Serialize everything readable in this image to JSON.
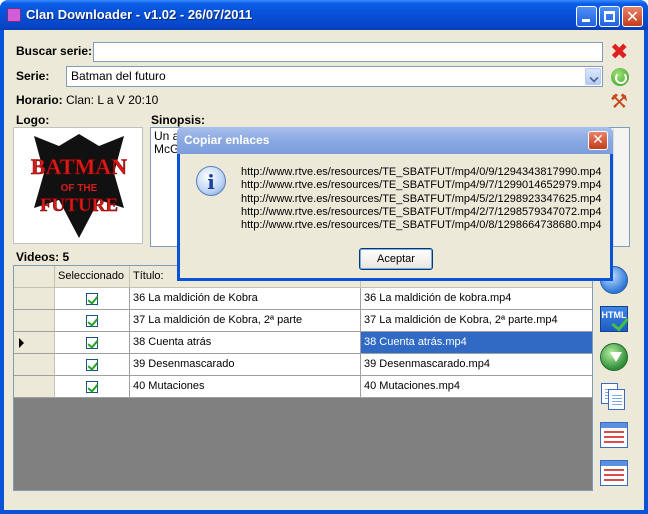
{
  "window": {
    "title": "Clan Downloader - v1.02 - 26/07/2011"
  },
  "form": {
    "search_label": "Buscar serie:",
    "search_value": "",
    "series_label": "Serie:",
    "series_value": "Batman del futuro",
    "schedule_label": "Horario:",
    "schedule_value": "Clan: L a V 20:10",
    "logo_label": "Logo:",
    "synopsis_label": "Sinopsis:",
    "synopsis_text": "Un a\nMcG",
    "videos_label": "Videos: 5"
  },
  "logo": {
    "line1": "BATMAN",
    "line2": "OF THE",
    "line3": "FUTURE"
  },
  "grid": {
    "headers": [
      "",
      "Seleccionado",
      "Título:",
      ""
    ],
    "rows": [
      {
        "selected": true,
        "title": "36 La maldición de Kobra",
        "file": "36 La maldición de kobra.mp4",
        "current": false
      },
      {
        "selected": true,
        "title": "37 La maldición de Kobra, 2ª parte",
        "file": "37 La maldición de Kobra, 2ª parte.mp4",
        "current": false
      },
      {
        "selected": true,
        "title": "38 Cuenta atrás",
        "file": "38 Cuenta atrás.mp4",
        "current": true
      },
      {
        "selected": true,
        "title": "39 Desenmascarado",
        "file": "39 Desenmascarado.mp4",
        "current": false
      },
      {
        "selected": true,
        "title": "40 Mutaciones",
        "file": "40 Mutaciones.mp4",
        "current": false
      }
    ]
  },
  "dialog": {
    "title": "Copiar enlaces",
    "urls": [
      "http://www.rtve.es/resources/TE_SBATFUT/mp4/0/9/1294343817990.mp4",
      "http://www.rtve.es/resources/TE_SBATFUT/mp4/9/7/1299014652979.mp4",
      "http://www.rtve.es/resources/TE_SBATFUT/mp4/5/2/1298923347625.mp4",
      "http://www.rtve.es/resources/TE_SBATFUT/mp4/2/7/1298579347072.mp4",
      "http://www.rtve.es/resources/TE_SBATFUT/mp4/0/8/1298664738680.mp4"
    ],
    "ok_label": "Aceptar"
  },
  "colors": {
    "title_bar": "#0650d6",
    "selection": "#316ac5",
    "dialog_title": "#8aa8e2"
  }
}
